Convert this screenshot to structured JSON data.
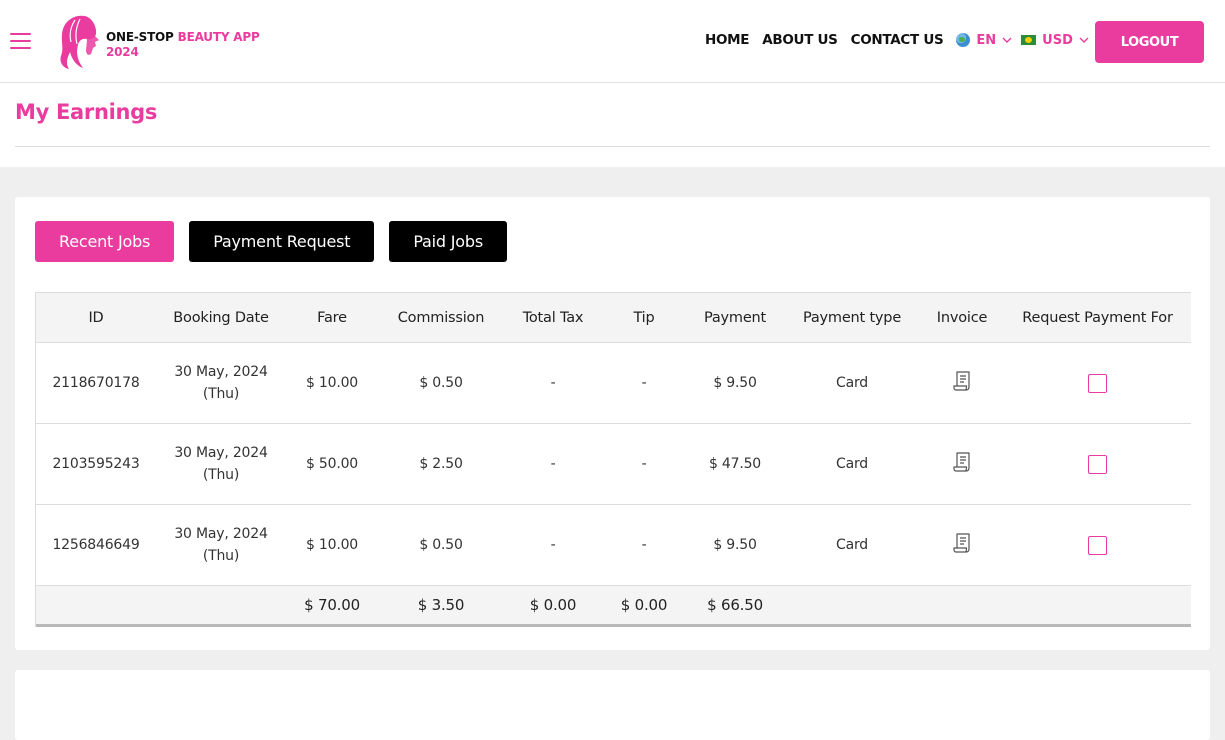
{
  "header": {
    "logo_line1_dark": "ONE-STOP",
    "logo_line1_pink": "BEAUTY APP",
    "logo_line2": "2024",
    "nav": [
      "HOME",
      "ABOUT US",
      "CONTACT US"
    ],
    "language": "EN",
    "currency": "USD",
    "logout_label": "LOGOUT",
    "accent_color": "#ea3c9e"
  },
  "page": {
    "title": "My Earnings"
  },
  "tabs": [
    {
      "label": "Recent Jobs",
      "active": true
    },
    {
      "label": "Payment Request",
      "active": false
    },
    {
      "label": "Paid Jobs",
      "active": false
    }
  ],
  "table": {
    "columns": [
      "ID",
      "Booking Date",
      "Fare",
      "Commission",
      "Total Tax",
      "Tip",
      "Payment",
      "Payment type",
      "Invoice",
      "Request Payment For"
    ],
    "rows": [
      {
        "id": "2118670178",
        "date_line1": "30 May, 2024",
        "date_line2": "(Thu)",
        "fare": "$ 10.00",
        "commission": "$ 0.50",
        "tax": "-",
        "tip": "-",
        "payment": "$ 9.50",
        "type": "Card"
      },
      {
        "id": "2103595243",
        "date_line1": "30 May, 2024",
        "date_line2": "(Thu)",
        "fare": "$ 50.00",
        "commission": "$ 2.50",
        "tax": "-",
        "tip": "-",
        "payment": "$ 47.50",
        "type": "Card"
      },
      {
        "id": "1256846649",
        "date_line1": "30 May, 2024",
        "date_line2": "(Thu)",
        "fare": "$ 10.00",
        "commission": "$ 0.50",
        "tax": "-",
        "tip": "-",
        "payment": "$ 9.50",
        "type": "Card"
      }
    ],
    "totals": {
      "fare": "$ 70.00",
      "commission": "$ 3.50",
      "tax": "$ 0.00",
      "tip": "$ 0.00",
      "payment": "$ 66.50"
    }
  },
  "icons": {
    "menu": "hamburger-icon",
    "invoice": "receipt-icon",
    "language": "globe-icon",
    "currency": "flag-icon"
  }
}
